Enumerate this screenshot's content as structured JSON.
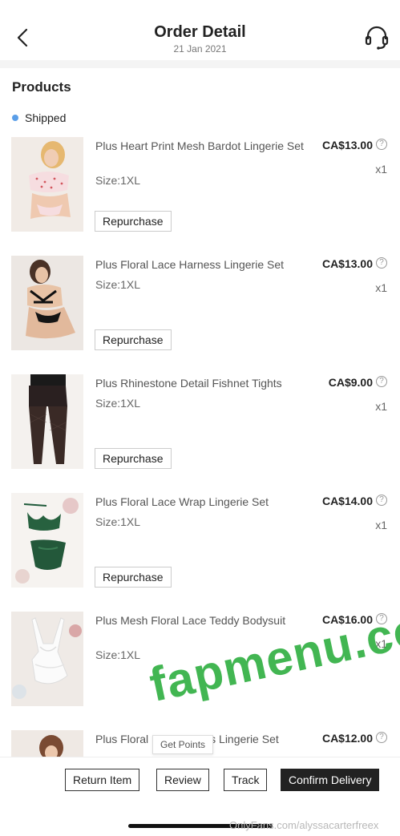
{
  "header": {
    "title": "Order Detail",
    "date": "21 Jan 2021"
  },
  "section": {
    "title": "Products",
    "status": "Shipped",
    "status_color": "#5a9ee8"
  },
  "items": [
    {
      "name": "Plus Heart Print Mesh Bardot Lingerie Set",
      "size": "Size:1XL",
      "price": "CA$13.00",
      "qty": "x1",
      "action": "Repurchase"
    },
    {
      "name": "Plus Floral Lace Harness Lingerie Set",
      "size": "Size:1XL",
      "price": "CA$13.00",
      "qty": "x1",
      "action": "Repurchase"
    },
    {
      "name": "Plus Rhinestone Detail Fishnet Tights",
      "size": "Size:1XL",
      "price": "CA$9.00",
      "qty": "x1",
      "action": "Repurchase"
    },
    {
      "name": "Plus Floral Lace Wrap Lingerie Set",
      "size": "Size:1XL",
      "price": "CA$14.00",
      "qty": "x1",
      "action": "Repurchase"
    },
    {
      "name": "Plus Mesh Floral Lace Teddy Bodysuit",
      "size": "Size:1XL",
      "price": "CA$16.00",
      "qty": "x1"
    },
    {
      "name": "Plus Floral",
      "name_tail": "ss Lingerie Set",
      "price": "CA$12.00"
    }
  ],
  "help_icon": "?",
  "tooltip": "Get Points",
  "actions": {
    "return_item": "Return Item",
    "review": "Review",
    "track": "Track",
    "confirm_delivery": "Confirm Delivery"
  },
  "watermarks": {
    "site": "fapmenu.com",
    "source": "OnlyFans.com/alyssacarterfreex"
  },
  "icons": {
    "back": "chevron-left-icon",
    "support": "headset-icon"
  }
}
